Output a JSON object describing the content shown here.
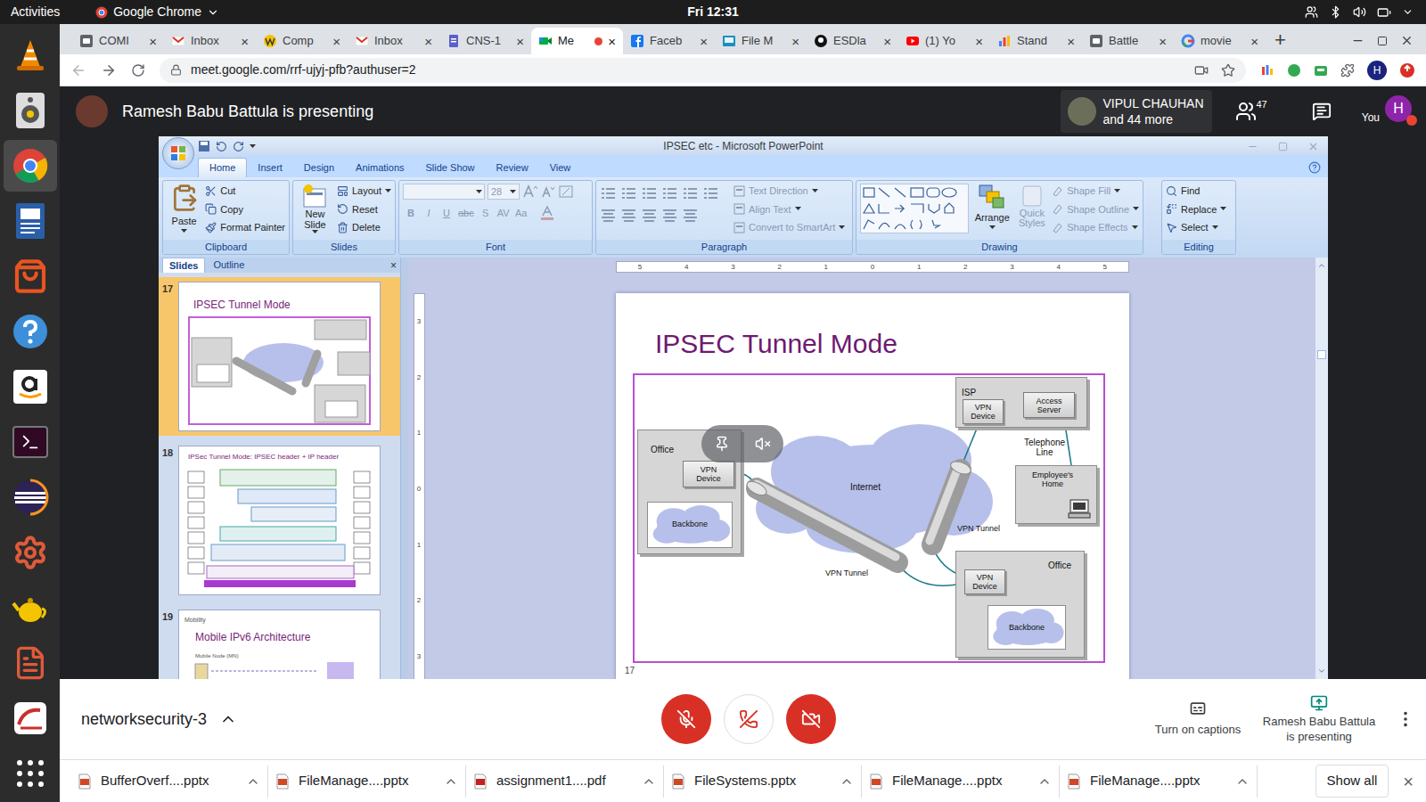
{
  "top_bar": {
    "activities": "Activities",
    "app": "Google Chrome",
    "clock": "Fri 12:31"
  },
  "browser": {
    "tabs": [
      {
        "label": "COMI",
        "kind": "cc",
        "selected": false,
        "recording": false
      },
      {
        "label": "Inbox",
        "kind": "gmail",
        "selected": false,
        "recording": false
      },
      {
        "label": "Comp",
        "kind": "w",
        "selected": false,
        "recording": false
      },
      {
        "label": "Inbox",
        "kind": "gmail",
        "selected": false,
        "recording": false
      },
      {
        "label": "CNS-1",
        "kind": "docs",
        "selected": false,
        "recording": false
      },
      {
        "label": "Me",
        "kind": "meet",
        "selected": true,
        "recording": true
      },
      {
        "label": "Faceb",
        "kind": "facebook",
        "selected": false,
        "recording": false
      },
      {
        "label": "File M",
        "kind": "file",
        "selected": false,
        "recording": false
      },
      {
        "label": "ESDla",
        "kind": "github",
        "selected": false,
        "recording": false
      },
      {
        "label": "(1) Yo",
        "kind": "youtube",
        "selected": false,
        "recording": false
      },
      {
        "label": "Stand",
        "kind": "chart",
        "selected": false,
        "recording": false
      },
      {
        "label": "Battle",
        "kind": "cc",
        "selected": false,
        "recording": false
      },
      {
        "label": "movie",
        "kind": "google",
        "selected": false,
        "recording": false
      }
    ],
    "tab_close": "×",
    "new_tab": "+",
    "address": "meet.google.com/rrf-ujyj-pfb?authuser=2",
    "profile": "H"
  },
  "meet": {
    "presenting_banner": "Ramesh Babu Battula is presenting",
    "participant_name": "VIPUL CHAUHAN",
    "participant_more": "and 44 more",
    "people_count": "47",
    "you_label": "You",
    "avatar": "H",
    "meeting_name": "networksecurity-3",
    "mic_on": false,
    "camera_on": false,
    "captions_label": "Turn on captions",
    "presenting_label": "Ramesh Babu Battula is presenting"
  },
  "powerpoint": {
    "title": "IPSEC etc - Microsoft PowerPoint",
    "ribbon_tabs": [
      {
        "label": "Home",
        "selected": true
      },
      {
        "label": "Insert",
        "selected": false
      },
      {
        "label": "Design",
        "selected": false
      },
      {
        "label": "Animations",
        "selected": false
      },
      {
        "label": "Slide Show",
        "selected": false
      },
      {
        "label": "Review",
        "selected": false
      },
      {
        "label": "View",
        "selected": false
      }
    ],
    "groups": {
      "clipboard": {
        "label": "Clipboard",
        "paste": "Paste",
        "items": [
          "Cut",
          "Copy",
          "Format Painter"
        ]
      },
      "slides": {
        "label": "Slides",
        "new_slide": "New Slide",
        "items": [
          "Layout",
          "Reset",
          "Delete"
        ]
      },
      "font": {
        "label": "Font",
        "size": "28",
        "disabled": true,
        "buttons": [
          "B",
          "I",
          "U",
          "abc",
          "S",
          "AV",
          "Aa"
        ]
      },
      "paragraph": {
        "label": "Paragraph",
        "disabled": true,
        "items": [
          "Text Direction",
          "Align Text",
          "Convert to SmartArt"
        ]
      },
      "drawing": {
        "label": "Drawing",
        "arrange": "Arrange",
        "quick_styles": "Quick Styles",
        "quick_styles_disabled": true,
        "items": [
          "Shape Fill",
          "Shape Outline",
          "Shape Effects"
        ],
        "items_disabled": true
      },
      "editing": {
        "label": "Editing",
        "items": [
          "Find",
          "Replace",
          "Select"
        ]
      }
    },
    "pane_tabs": [
      {
        "label": "Slides",
        "selected": true
      },
      {
        "label": "Outline",
        "selected": false
      }
    ],
    "pane_close": "×",
    "thumbnails": [
      {
        "number": "17",
        "kind": "tunnel",
        "selected": true,
        "header": "",
        "title": "IPSEC Tunnel Mode",
        "note": ""
      },
      {
        "number": "18",
        "kind": "stack",
        "selected": false,
        "header": "",
        "title": "IPSec Tunnel Mode: IPSEC header + IP header",
        "note": ""
      },
      {
        "number": "19",
        "kind": "mobile",
        "selected": false,
        "header": "Mobility",
        "title": "Mobile IPv6 Architecture",
        "note": "Mobile Node (MN)"
      }
    ],
    "h_ruler": [
      "5",
      "4",
      "3",
      "2",
      "1",
      "0",
      "1",
      "2",
      "3",
      "4",
      "5"
    ],
    "v_ruler": [
      "3",
      "2",
      "1",
      "0",
      "1",
      "2",
      "3"
    ],
    "slide": {
      "title": "IPSEC Tunnel Mode",
      "number": "17",
      "diagram": {
        "left_office": {
          "label": "Office",
          "device": "VPN Device",
          "backbone": "Backbone"
        },
        "internet": "Internet",
        "isp": {
          "label": "ISP",
          "device": "VPN Device",
          "server": "Access Server"
        },
        "telephone": "Telephone Line",
        "home": "Employee's Home",
        "right_office": {
          "label": "Office",
          "device": "VPN Device",
          "backbone": "Backbone"
        },
        "tunnels": [
          "VPN Tunnel",
          "VPN Tunnel"
        ]
      }
    }
  },
  "downloads": {
    "items": [
      {
        "name": "BufferOverf....pptx",
        "kind": "pptx"
      },
      {
        "name": "FileManage....pptx",
        "kind": "pptx"
      },
      {
        "name": "assignment1....pdf",
        "kind": "pdf"
      },
      {
        "name": "FileSystems.pptx",
        "kind": "pptx"
      },
      {
        "name": "FileManage....pptx",
        "kind": "pptx"
      },
      {
        "name": "FileManage....pptx",
        "kind": "pptx"
      }
    ],
    "show_all": "Show all",
    "close": "×"
  }
}
